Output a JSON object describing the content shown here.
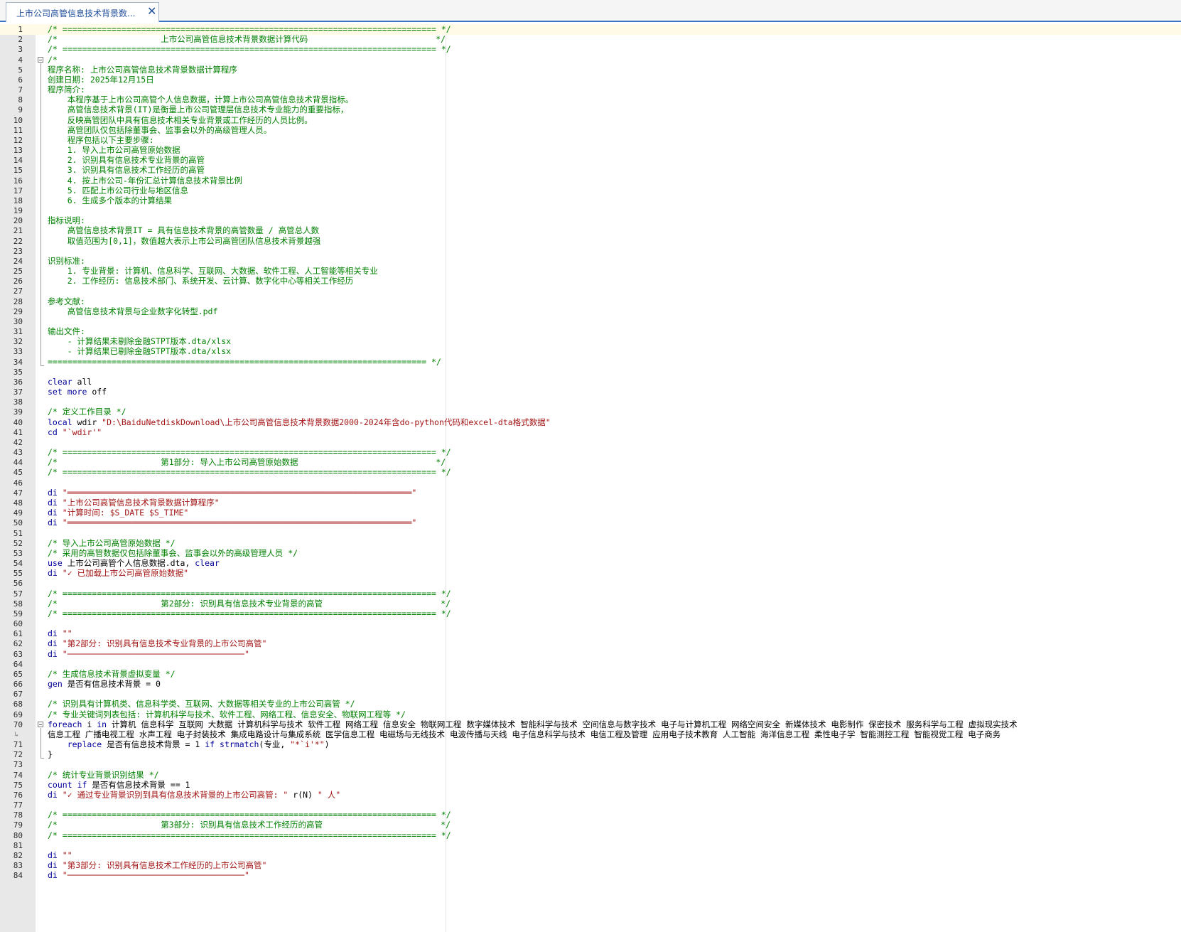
{
  "tab": {
    "title": "上市公司高管信息技术背景数...",
    "close_glyph": "✕"
  },
  "editor": {
    "current_line": 1,
    "fold_markers": [
      4,
      70
    ],
    "wrapped_line": 70,
    "lines": [
      {
        "n": 1,
        "text": "/* ============================================================================ */",
        "type": "comment"
      },
      {
        "n": 2,
        "text": "/*                     上市公司高管信息技术背景数据计算代码                          */",
        "type": "comment"
      },
      {
        "n": 3,
        "text": "/* ============================================================================ */",
        "type": "comment"
      },
      {
        "n": 4,
        "text": "/*",
        "type": "comment"
      },
      {
        "n": 5,
        "text": "程序名称: 上市公司高管信息技术背景数据计算程序",
        "type": "comment"
      },
      {
        "n": 6,
        "text": "创建日期: 2025年12月15日",
        "type": "comment"
      },
      {
        "n": 7,
        "text": "程序简介:",
        "type": "comment"
      },
      {
        "n": 8,
        "text": "    本程序基于上市公司高管个人信息数据，计算上市公司高管信息技术背景指标。",
        "type": "comment"
      },
      {
        "n": 9,
        "text": "    高管信息技术背景(IT)是衡量上市公司管理层信息技术专业能力的重要指标，",
        "type": "comment"
      },
      {
        "n": 10,
        "text": "    反映高管团队中具有信息技术相关专业背景或工作经历的人员比例。",
        "type": "comment"
      },
      {
        "n": 11,
        "text": "    高管团队仅包括除董事会、监事会以外的高级管理人员。",
        "type": "comment"
      },
      {
        "n": 12,
        "text": "    程序包括以下主要步骤:",
        "type": "comment"
      },
      {
        "n": 13,
        "text": "    1. 导入上市公司高管原始数据",
        "type": "comment"
      },
      {
        "n": 14,
        "text": "    2. 识别具有信息技术专业背景的高管",
        "type": "comment"
      },
      {
        "n": 15,
        "text": "    3. 识别具有信息技术工作经历的高管",
        "type": "comment"
      },
      {
        "n": 16,
        "text": "    4. 按上市公司-年份汇总计算信息技术背景比例",
        "type": "comment"
      },
      {
        "n": 17,
        "text": "    5. 匹配上市公司行业与地区信息",
        "type": "comment"
      },
      {
        "n": 18,
        "text": "    6. 生成多个版本的计算结果",
        "type": "comment"
      },
      {
        "n": 19,
        "text": "",
        "type": "comment"
      },
      {
        "n": 20,
        "text": "指标说明:",
        "type": "comment"
      },
      {
        "n": 21,
        "text": "    高管信息技术背景IT = 具有信息技术背景的高管数量 / 高管总人数",
        "type": "comment"
      },
      {
        "n": 22,
        "text": "    取值范围为[0,1]，数值越大表示上市公司高管团队信息技术背景越强",
        "type": "comment"
      },
      {
        "n": 23,
        "text": "",
        "type": "comment"
      },
      {
        "n": 24,
        "text": "识别标准:",
        "type": "comment"
      },
      {
        "n": 25,
        "text": "    1. 专业背景: 计算机、信息科学、互联网、大数据、软件工程、人工智能等相关专业",
        "type": "comment"
      },
      {
        "n": 26,
        "text": "    2. 工作经历: 信息技术部门、系统开发、云计算、数字化中心等相关工作经历",
        "type": "comment"
      },
      {
        "n": 27,
        "text": "",
        "type": "comment"
      },
      {
        "n": 28,
        "text": "参考文献:",
        "type": "comment"
      },
      {
        "n": 29,
        "text": "    高管信息技术背景与企业数字化转型.pdf",
        "type": "comment"
      },
      {
        "n": 30,
        "text": "",
        "type": "comment"
      },
      {
        "n": 31,
        "text": "输出文件:",
        "type": "comment"
      },
      {
        "n": 32,
        "text": "    - 计算结果未剔除金融STPT版本.dta/xlsx",
        "type": "comment"
      },
      {
        "n": 33,
        "text": "    - 计算结果已剔除金融STPT版本.dta/xlsx",
        "type": "comment"
      },
      {
        "n": 34,
        "text": "============================================================================= */",
        "type": "comment"
      },
      {
        "n": 35,
        "text": "",
        "type": "plain"
      },
      {
        "n": 36,
        "tokens": [
          {
            "t": "clear",
            "c": "kw"
          },
          {
            "t": " all",
            "c": "plain"
          }
        ]
      },
      {
        "n": 37,
        "tokens": [
          {
            "t": "set more",
            "c": "kw"
          },
          {
            "t": " off",
            "c": "plain"
          }
        ]
      },
      {
        "n": 38,
        "text": "",
        "type": "plain"
      },
      {
        "n": 39,
        "text": "/* 定义工作目录 */",
        "type": "comment"
      },
      {
        "n": 40,
        "tokens": [
          {
            "t": "local",
            "c": "kw"
          },
          {
            "t": " wdir ",
            "c": "plain"
          },
          {
            "t": "\"D:\\BaiduNetdiskDownload\\上市公司高管信息技术背景数据2000-2024年含do-python代码和excel-dta格式数据\"",
            "c": "str"
          }
        ]
      },
      {
        "n": 41,
        "tokens": [
          {
            "t": "cd",
            "c": "kw"
          },
          {
            "t": " ",
            "c": "plain"
          },
          {
            "t": "\"`wdir'\"",
            "c": "str"
          }
        ]
      },
      {
        "n": 42,
        "text": "",
        "type": "plain"
      },
      {
        "n": 43,
        "text": "/* ============================================================================ */",
        "type": "comment"
      },
      {
        "n": 44,
        "text": "/*                     第1部分: 导入上市公司高管原始数据                            */",
        "type": "comment"
      },
      {
        "n": 45,
        "text": "/* ============================================================================ */",
        "type": "comment"
      },
      {
        "n": 46,
        "text": "",
        "type": "plain"
      },
      {
        "n": 47,
        "tokens": [
          {
            "t": "di",
            "c": "kw"
          },
          {
            "t": " ",
            "c": "plain"
          },
          {
            "t": "\"══════════════════════════════════════════════════════════════════════\"",
            "c": "str"
          }
        ]
      },
      {
        "n": 48,
        "tokens": [
          {
            "t": "di",
            "c": "kw"
          },
          {
            "t": " ",
            "c": "plain"
          },
          {
            "t": "\"上市公司高管信息技术背景数据计算程序\"",
            "c": "str"
          }
        ]
      },
      {
        "n": 49,
        "tokens": [
          {
            "t": "di",
            "c": "kw"
          },
          {
            "t": " ",
            "c": "plain"
          },
          {
            "t": "\"计算时间: $S_DATE $S_TIME\"",
            "c": "str"
          }
        ]
      },
      {
        "n": 50,
        "tokens": [
          {
            "t": "di",
            "c": "kw"
          },
          {
            "t": " ",
            "c": "plain"
          },
          {
            "t": "\"══════════════════════════════════════════════════════════════════════\"",
            "c": "str"
          }
        ]
      },
      {
        "n": 51,
        "text": "",
        "type": "plain"
      },
      {
        "n": 52,
        "text": "/* 导入上市公司高管原始数据 */",
        "type": "comment"
      },
      {
        "n": 53,
        "text": "/* 采用的高管数据仅包括除董事会、监事会以外的高级管理人员 */",
        "type": "comment"
      },
      {
        "n": 54,
        "tokens": [
          {
            "t": "use",
            "c": "kw"
          },
          {
            "t": " 上市公司高管个人信息数据.dta, ",
            "c": "plain"
          },
          {
            "t": "clear",
            "c": "kw"
          }
        ]
      },
      {
        "n": 55,
        "tokens": [
          {
            "t": "di",
            "c": "kw"
          },
          {
            "t": " ",
            "c": "plain"
          },
          {
            "t": "\"✓ 已加载上市公司高管原始数据\"",
            "c": "str"
          }
        ]
      },
      {
        "n": 56,
        "text": "",
        "type": "plain"
      },
      {
        "n": 57,
        "text": "/* ============================================================================ */",
        "type": "comment"
      },
      {
        "n": 58,
        "text": "/*                     第2部分: 识别具有信息技术专业背景的高管                        */",
        "type": "comment"
      },
      {
        "n": 59,
        "text": "/* ============================================================================ */",
        "type": "comment"
      },
      {
        "n": 60,
        "text": "",
        "type": "plain"
      },
      {
        "n": 61,
        "tokens": [
          {
            "t": "di",
            "c": "kw"
          },
          {
            "t": " ",
            "c": "plain"
          },
          {
            "t": "\"\"",
            "c": "str"
          }
        ]
      },
      {
        "n": 62,
        "tokens": [
          {
            "t": "di",
            "c": "kw"
          },
          {
            "t": " ",
            "c": "plain"
          },
          {
            "t": "\"第2部分: 识别具有信息技术专业背景的上市公司高管\"",
            "c": "str"
          }
        ]
      },
      {
        "n": 63,
        "tokens": [
          {
            "t": "di",
            "c": "kw"
          },
          {
            "t": " ",
            "c": "plain"
          },
          {
            "t": "\"────────────────────────────────────\"",
            "c": "str"
          }
        ]
      },
      {
        "n": 64,
        "text": "",
        "type": "plain"
      },
      {
        "n": 65,
        "text": "/* 生成信息技术背景虚拟变量 */",
        "type": "comment"
      },
      {
        "n": 66,
        "tokens": [
          {
            "t": "gen",
            "c": "kw"
          },
          {
            "t": " 是否有信息技术背景 = 0",
            "c": "plain"
          }
        ]
      },
      {
        "n": 67,
        "text": "",
        "type": "plain"
      },
      {
        "n": 68,
        "text": "/* 识别具有计算机类、信息科学类、互联网、大数据等相关专业的上市公司高管 */",
        "type": "comment"
      },
      {
        "n": 69,
        "text": "/* 专业关键词列表包括: 计算机科学与技术、软件工程、网络工程、信息安全、物联网工程等 */",
        "type": "comment"
      },
      {
        "n": 70,
        "tokens": [
          {
            "t": "foreach",
            "c": "kw"
          },
          {
            "t": " i ",
            "c": "plain"
          },
          {
            "t": "in",
            "c": "kw"
          },
          {
            "t": " 计算机 信息科学 互联网 大数据 计算机科学与技术 软件工程 网络工程 信息安全 物联网工程 数字媒体技术 智能科学与技术 空间信息与数字技术 电子与计算机工程 网络空间安全 新媒体技术 电影制作 保密技术 服务科学与工程 虚拟现实技术",
            "c": "plain"
          }
        ]
      },
      {
        "n": 0,
        "wrap": true,
        "tokens": [
          {
            "t": "信息工程 广播电视工程 水声工程 电子封装技术 集成电路设计与集成系统 医学信息工程 电磁场与无线技术 电波传播与天线 电子信息科学与技术 电信工程及管理 应用电子技术教育 人工智能 海洋信息工程 柔性电子学 智能测控工程 智能视觉工程 电子商务",
            "c": "plain"
          }
        ]
      },
      {
        "n": 71,
        "tokens": [
          {
            "t": "    replace",
            "c": "kw"
          },
          {
            "t": " 是否有信息技术背景 = 1 ",
            "c": "plain"
          },
          {
            "t": "if",
            "c": "kw"
          },
          {
            "t": " ",
            "c": "plain"
          },
          {
            "t": "strmatch",
            "c": "kw"
          },
          {
            "t": "(专业, ",
            "c": "plain"
          },
          {
            "t": "\"*`i'*\"",
            "c": "str"
          },
          {
            "t": ")",
            "c": "plain"
          }
        ]
      },
      {
        "n": 72,
        "tokens": [
          {
            "t": "}",
            "c": "plain"
          }
        ]
      },
      {
        "n": 73,
        "text": "",
        "type": "plain"
      },
      {
        "n": 74,
        "text": "/* 统计专业背景识别结果 */",
        "type": "comment"
      },
      {
        "n": 75,
        "tokens": [
          {
            "t": "count",
            "c": "kw"
          },
          {
            "t": " ",
            "c": "plain"
          },
          {
            "t": "if",
            "c": "kw"
          },
          {
            "t": " 是否有信息技术背景 == 1",
            "c": "plain"
          }
        ]
      },
      {
        "n": 76,
        "tokens": [
          {
            "t": "di",
            "c": "kw"
          },
          {
            "t": " ",
            "c": "plain"
          },
          {
            "t": "\"✓ 通过专业背景识别到具有信息技术背景的上市公司高管: \"",
            "c": "str"
          },
          {
            "t": " r(N) ",
            "c": "plain"
          },
          {
            "t": "\" 人\"",
            "c": "str"
          }
        ]
      },
      {
        "n": 77,
        "text": "",
        "type": "plain"
      },
      {
        "n": 78,
        "text": "/* ============================================================================ */",
        "type": "comment"
      },
      {
        "n": 79,
        "text": "/*                     第3部分: 识别具有信息技术工作经历的高管                        */",
        "type": "comment"
      },
      {
        "n": 80,
        "text": "/* ============================================================================ */",
        "type": "comment"
      },
      {
        "n": 81,
        "text": "",
        "type": "plain"
      },
      {
        "n": 82,
        "tokens": [
          {
            "t": "di",
            "c": "kw"
          },
          {
            "t": " ",
            "c": "plain"
          },
          {
            "t": "\"\"",
            "c": "str"
          }
        ]
      },
      {
        "n": 83,
        "tokens": [
          {
            "t": "di",
            "c": "kw"
          },
          {
            "t": " ",
            "c": "plain"
          },
          {
            "t": "\"第3部分: 识别具有信息技术工作经历的上市公司高管\"",
            "c": "str"
          }
        ]
      },
      {
        "n": 84,
        "tokens": [
          {
            "t": "di",
            "c": "kw"
          },
          {
            "t": " ",
            "c": "plain"
          },
          {
            "t": "\"────────────────────────────────────\"",
            "c": "str"
          }
        ]
      }
    ]
  }
}
